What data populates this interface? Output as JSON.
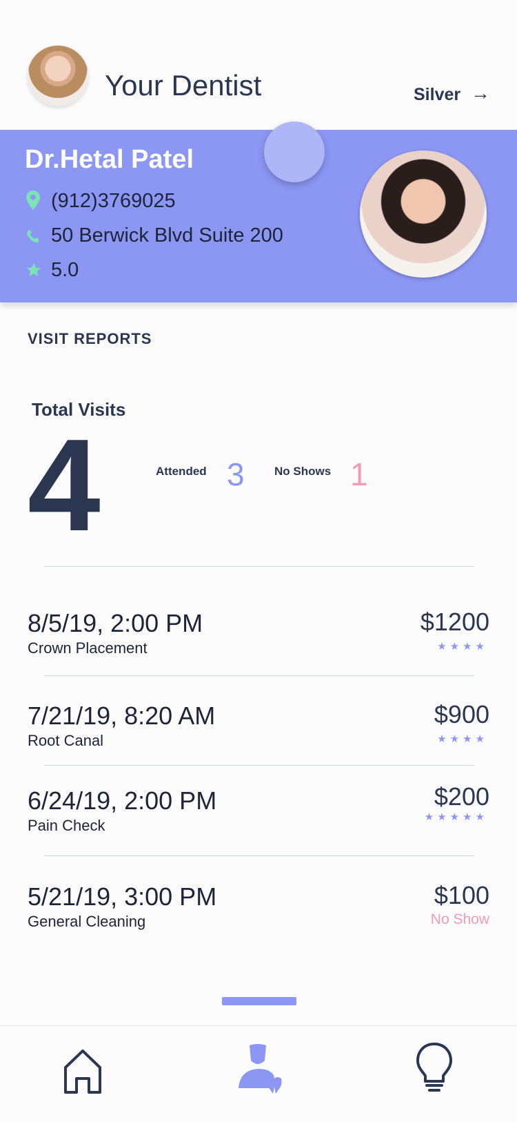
{
  "header": {
    "title": "Your Dentist",
    "tier": "Silver",
    "tier_arrow": "→"
  },
  "dentist": {
    "name": "Dr.Hetal Patel",
    "phone": "(912)3769025",
    "address": "50 Berwick Blvd Suite 200",
    "rating": "5.0"
  },
  "reports": {
    "section_title": "VISIT REPORTS",
    "total_label": "Total Visits",
    "total": "4",
    "attended_label": "Attended",
    "attended": "3",
    "noshow_label": "No Shows",
    "noshows": "1"
  },
  "visits": [
    {
      "date": "8/5/19, 2:00 PM",
      "type": "Crown Placement",
      "price": "$1200",
      "stars": "★★★★"
    },
    {
      "date": "7/21/19, 8:20 AM",
      "type": "Root Canal",
      "price": "$900",
      "stars": "★★★★"
    },
    {
      "date": "6/24/19, 2:00 PM",
      "type": "Pain Check",
      "price": "$200",
      "stars": "★★★★★"
    },
    {
      "date": "5/21/19, 3:00 PM",
      "type": "General Cleaning",
      "price": "$100",
      "status": "No Show"
    }
  ],
  "icons": {
    "location": "location-pin-icon",
    "phone": "phone-icon",
    "rating": "star-icon",
    "nav_home": "home-icon",
    "nav_dentist": "dentist-profile-icon",
    "nav_tips": "lightbulb-icon"
  },
  "colors": {
    "accent": "#8c97f4",
    "text": "#2b3650",
    "noshow": "#f29bb6",
    "icon_green": "#7be3b5"
  }
}
